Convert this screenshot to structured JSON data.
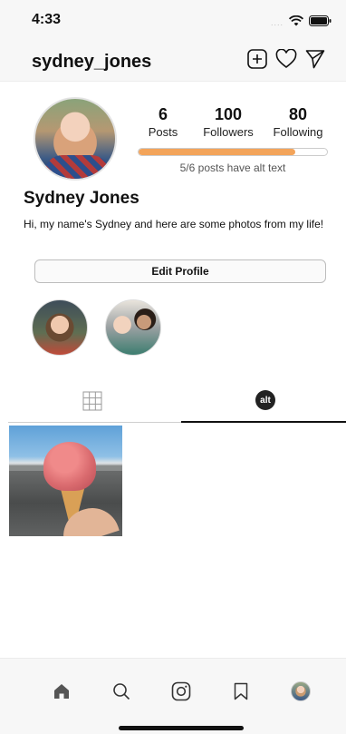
{
  "status": {
    "time": "4:33",
    "signal_dots": "...."
  },
  "header": {
    "username": "sydney_jones"
  },
  "stats": {
    "posts": {
      "count": "6",
      "label": "Posts"
    },
    "followers": {
      "count": "100",
      "label": "Followers"
    },
    "following": {
      "count": "80",
      "label": "Following"
    }
  },
  "alt_text": {
    "progress": 0.833,
    "caption": "5/6 posts have alt text"
  },
  "profile": {
    "name": "Sydney Jones",
    "bio": "Hi, my name's Sydney and here are some photos from my life!",
    "edit_label": "Edit Profile"
  },
  "tabs": {
    "alt_badge": "alt",
    "active": "alt"
  },
  "colors": {
    "progress_fill": "#f3a45a",
    "progress_border": "#cccccc",
    "active_tab": "#111111"
  },
  "icons": {
    "header": [
      "plus-square-icon",
      "heart-icon",
      "send-icon"
    ],
    "nav": [
      "home-icon",
      "search-icon",
      "reels-icon",
      "bookmark-icon",
      "profile-avatar"
    ]
  }
}
